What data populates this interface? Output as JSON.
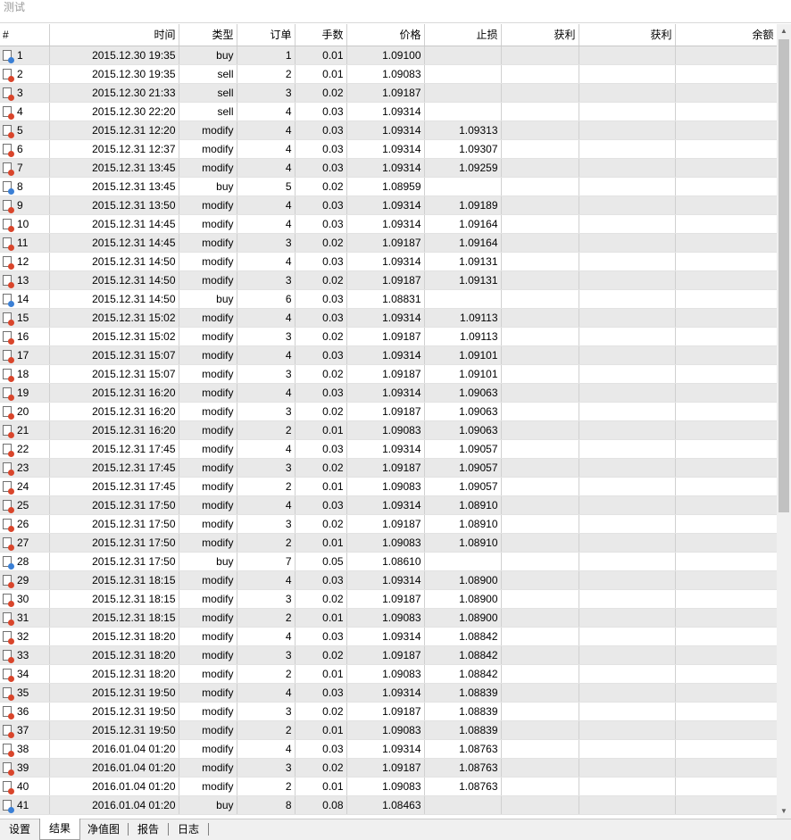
{
  "window": {
    "title": "测试"
  },
  "colors": {
    "buy_dot": "#3a7fd5",
    "sell_dot": "#d9452b"
  },
  "table": {
    "columns": [
      "#",
      "时间",
      "类型",
      "订单",
      "手数",
      "价格",
      "止损",
      "获利",
      "获利",
      "余额"
    ],
    "rows": [
      {
        "n": "1",
        "time": "2015.12.30 19:35",
        "type": "buy",
        "order": "1",
        "lots": "0.01",
        "price": "1.09100",
        "sl": "",
        "icon": "blue-dot-doc-icon"
      },
      {
        "n": "2",
        "time": "2015.12.30 19:35",
        "type": "sell",
        "order": "2",
        "lots": "0.01",
        "price": "1.09083",
        "sl": "",
        "icon": "red-dot-doc-icon"
      },
      {
        "n": "3",
        "time": "2015.12.30 21:33",
        "type": "sell",
        "order": "3",
        "lots": "0.02",
        "price": "1.09187",
        "sl": "",
        "icon": "red-dot-doc-icon"
      },
      {
        "n": "4",
        "time": "2015.12.30 22:20",
        "type": "sell",
        "order": "4",
        "lots": "0.03",
        "price": "1.09314",
        "sl": "",
        "icon": "red-dot-doc-icon"
      },
      {
        "n": "5",
        "time": "2015.12.31 12:20",
        "type": "modify",
        "order": "4",
        "lots": "0.03",
        "price": "1.09314",
        "sl": "1.09313",
        "icon": "red-dot-doc-icon"
      },
      {
        "n": "6",
        "time": "2015.12.31 12:37",
        "type": "modify",
        "order": "4",
        "lots": "0.03",
        "price": "1.09314",
        "sl": "1.09307",
        "icon": "red-dot-doc-icon"
      },
      {
        "n": "7",
        "time": "2015.12.31 13:45",
        "type": "modify",
        "order": "4",
        "lots": "0.03",
        "price": "1.09314",
        "sl": "1.09259",
        "icon": "red-dot-doc-icon"
      },
      {
        "n": "8",
        "time": "2015.12.31 13:45",
        "type": "buy",
        "order": "5",
        "lots": "0.02",
        "price": "1.08959",
        "sl": "",
        "icon": "blue-dot-doc-icon"
      },
      {
        "n": "9",
        "time": "2015.12.31 13:50",
        "type": "modify",
        "order": "4",
        "lots": "0.03",
        "price": "1.09314",
        "sl": "1.09189",
        "icon": "red-dot-doc-icon"
      },
      {
        "n": "10",
        "time": "2015.12.31 14:45",
        "type": "modify",
        "order": "4",
        "lots": "0.03",
        "price": "1.09314",
        "sl": "1.09164",
        "icon": "red-dot-doc-icon"
      },
      {
        "n": "11",
        "time": "2015.12.31 14:45",
        "type": "modify",
        "order": "3",
        "lots": "0.02",
        "price": "1.09187",
        "sl": "1.09164",
        "icon": "red-dot-doc-icon"
      },
      {
        "n": "12",
        "time": "2015.12.31 14:50",
        "type": "modify",
        "order": "4",
        "lots": "0.03",
        "price": "1.09314",
        "sl": "1.09131",
        "icon": "red-dot-doc-icon"
      },
      {
        "n": "13",
        "time": "2015.12.31 14:50",
        "type": "modify",
        "order": "3",
        "lots": "0.02",
        "price": "1.09187",
        "sl": "1.09131",
        "icon": "red-dot-doc-icon"
      },
      {
        "n": "14",
        "time": "2015.12.31 14:50",
        "type": "buy",
        "order": "6",
        "lots": "0.03",
        "price": "1.08831",
        "sl": "",
        "icon": "blue-dot-doc-icon"
      },
      {
        "n": "15",
        "time": "2015.12.31 15:02",
        "type": "modify",
        "order": "4",
        "lots": "0.03",
        "price": "1.09314",
        "sl": "1.09113",
        "icon": "red-dot-doc-icon"
      },
      {
        "n": "16",
        "time": "2015.12.31 15:02",
        "type": "modify",
        "order": "3",
        "lots": "0.02",
        "price": "1.09187",
        "sl": "1.09113",
        "icon": "red-dot-doc-icon"
      },
      {
        "n": "17",
        "time": "2015.12.31 15:07",
        "type": "modify",
        "order": "4",
        "lots": "0.03",
        "price": "1.09314",
        "sl": "1.09101",
        "icon": "red-dot-doc-icon"
      },
      {
        "n": "18",
        "time": "2015.12.31 15:07",
        "type": "modify",
        "order": "3",
        "lots": "0.02",
        "price": "1.09187",
        "sl": "1.09101",
        "icon": "red-dot-doc-icon"
      },
      {
        "n": "19",
        "time": "2015.12.31 16:20",
        "type": "modify",
        "order": "4",
        "lots": "0.03",
        "price": "1.09314",
        "sl": "1.09063",
        "icon": "red-dot-doc-icon"
      },
      {
        "n": "20",
        "time": "2015.12.31 16:20",
        "type": "modify",
        "order": "3",
        "lots": "0.02",
        "price": "1.09187",
        "sl": "1.09063",
        "icon": "red-dot-doc-icon"
      },
      {
        "n": "21",
        "time": "2015.12.31 16:20",
        "type": "modify",
        "order": "2",
        "lots": "0.01",
        "price": "1.09083",
        "sl": "1.09063",
        "icon": "red-dot-doc-icon"
      },
      {
        "n": "22",
        "time": "2015.12.31 17:45",
        "type": "modify",
        "order": "4",
        "lots": "0.03",
        "price": "1.09314",
        "sl": "1.09057",
        "icon": "red-dot-doc-icon"
      },
      {
        "n": "23",
        "time": "2015.12.31 17:45",
        "type": "modify",
        "order": "3",
        "lots": "0.02",
        "price": "1.09187",
        "sl": "1.09057",
        "icon": "red-dot-doc-icon"
      },
      {
        "n": "24",
        "time": "2015.12.31 17:45",
        "type": "modify",
        "order": "2",
        "lots": "0.01",
        "price": "1.09083",
        "sl": "1.09057",
        "icon": "red-dot-doc-icon"
      },
      {
        "n": "25",
        "time": "2015.12.31 17:50",
        "type": "modify",
        "order": "4",
        "lots": "0.03",
        "price": "1.09314",
        "sl": "1.08910",
        "icon": "red-dot-doc-icon"
      },
      {
        "n": "26",
        "time": "2015.12.31 17:50",
        "type": "modify",
        "order": "3",
        "lots": "0.02",
        "price": "1.09187",
        "sl": "1.08910",
        "icon": "red-dot-doc-icon"
      },
      {
        "n": "27",
        "time": "2015.12.31 17:50",
        "type": "modify",
        "order": "2",
        "lots": "0.01",
        "price": "1.09083",
        "sl": "1.08910",
        "icon": "red-dot-doc-icon"
      },
      {
        "n": "28",
        "time": "2015.12.31 17:50",
        "type": "buy",
        "order": "7",
        "lots": "0.05",
        "price": "1.08610",
        "sl": "",
        "icon": "blue-dot-doc-icon"
      },
      {
        "n": "29",
        "time": "2015.12.31 18:15",
        "type": "modify",
        "order": "4",
        "lots": "0.03",
        "price": "1.09314",
        "sl": "1.08900",
        "icon": "red-dot-doc-icon"
      },
      {
        "n": "30",
        "time": "2015.12.31 18:15",
        "type": "modify",
        "order": "3",
        "lots": "0.02",
        "price": "1.09187",
        "sl": "1.08900",
        "icon": "red-dot-doc-icon"
      },
      {
        "n": "31",
        "time": "2015.12.31 18:15",
        "type": "modify",
        "order": "2",
        "lots": "0.01",
        "price": "1.09083",
        "sl": "1.08900",
        "icon": "red-dot-doc-icon"
      },
      {
        "n": "32",
        "time": "2015.12.31 18:20",
        "type": "modify",
        "order": "4",
        "lots": "0.03",
        "price": "1.09314",
        "sl": "1.08842",
        "icon": "red-dot-doc-icon"
      },
      {
        "n": "33",
        "time": "2015.12.31 18:20",
        "type": "modify",
        "order": "3",
        "lots": "0.02",
        "price": "1.09187",
        "sl": "1.08842",
        "icon": "red-dot-doc-icon"
      },
      {
        "n": "34",
        "time": "2015.12.31 18:20",
        "type": "modify",
        "order": "2",
        "lots": "0.01",
        "price": "1.09083",
        "sl": "1.08842",
        "icon": "red-dot-doc-icon"
      },
      {
        "n": "35",
        "time": "2015.12.31 19:50",
        "type": "modify",
        "order": "4",
        "lots": "0.03",
        "price": "1.09314",
        "sl": "1.08839",
        "icon": "red-dot-doc-icon"
      },
      {
        "n": "36",
        "time": "2015.12.31 19:50",
        "type": "modify",
        "order": "3",
        "lots": "0.02",
        "price": "1.09187",
        "sl": "1.08839",
        "icon": "red-dot-doc-icon"
      },
      {
        "n": "37",
        "time": "2015.12.31 19:50",
        "type": "modify",
        "order": "2",
        "lots": "0.01",
        "price": "1.09083",
        "sl": "1.08839",
        "icon": "red-dot-doc-icon"
      },
      {
        "n": "38",
        "time": "2016.01.04 01:20",
        "type": "modify",
        "order": "4",
        "lots": "0.03",
        "price": "1.09314",
        "sl": "1.08763",
        "icon": "red-dot-doc-icon"
      },
      {
        "n": "39",
        "time": "2016.01.04 01:20",
        "type": "modify",
        "order": "3",
        "lots": "0.02",
        "price": "1.09187",
        "sl": "1.08763",
        "icon": "red-dot-doc-icon"
      },
      {
        "n": "40",
        "time": "2016.01.04 01:20",
        "type": "modify",
        "order": "2",
        "lots": "0.01",
        "price": "1.09083",
        "sl": "1.08763",
        "icon": "red-dot-doc-icon"
      },
      {
        "n": "41",
        "time": "2016.01.04 01:20",
        "type": "buy",
        "order": "8",
        "lots": "0.08",
        "price": "1.08463",
        "sl": "",
        "icon": "blue-dot-doc-icon"
      }
    ]
  },
  "scrollbar": {
    "up_icon": "scroll-up-arrow-icon",
    "down_icon": "scroll-down-arrow-icon"
  },
  "tabs": [
    {
      "label": "设置",
      "active": false
    },
    {
      "label": "结果",
      "active": true
    },
    {
      "label": "净值图",
      "active": false
    },
    {
      "label": "报告",
      "active": false
    },
    {
      "label": "日志",
      "active": false
    }
  ]
}
